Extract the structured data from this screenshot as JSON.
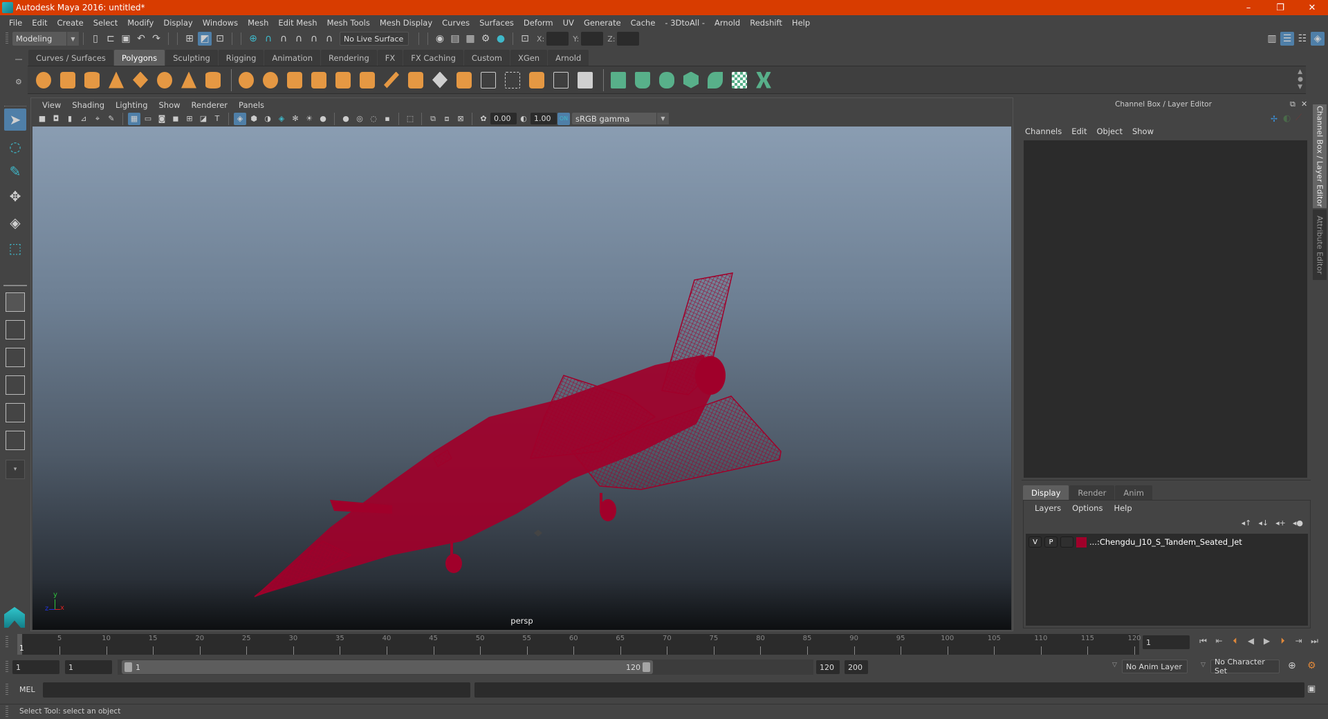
{
  "window": {
    "title": "Autodesk Maya 2016: untitled*",
    "controls": {
      "minimize": "–",
      "restore": "❐",
      "close": "✕"
    }
  },
  "menubar": [
    "File",
    "Edit",
    "Create",
    "Select",
    "Modify",
    "Display",
    "Windows",
    "Mesh",
    "Edit Mesh",
    "Mesh Tools",
    "Mesh Display",
    "Curves",
    "Surfaces",
    "Deform",
    "UV",
    "Generate",
    "Cache",
    "- 3DtoAll -",
    "Arnold",
    "Redshift",
    "Help"
  ],
  "statusline": {
    "menuset": "Modeling",
    "live_surface": "No Live Surface",
    "x_label": "X:",
    "y_label": "Y:",
    "z_label": "Z:",
    "x_value": "",
    "y_value": "",
    "z_value": ""
  },
  "shelf": {
    "tabs": [
      "Curves / Surfaces",
      "Polygons",
      "Sculpting",
      "Rigging",
      "Animation",
      "Rendering",
      "FX",
      "FX Caching",
      "Custom",
      "XGen",
      "Arnold"
    ],
    "active_tab": "Polygons",
    "icons": [
      "poly-sphere",
      "poly-cube",
      "poly-cylinder",
      "poly-cone",
      "poly-plane",
      "poly-torus",
      "poly-pyramid",
      "poly-pipe",
      "combine",
      "separate",
      "mirror",
      "smooth",
      "bevel",
      "bridge",
      "extrude",
      "multi-cut",
      "quad-draw",
      "target-weld",
      "connect",
      "edge-loop",
      "insert-edge-loop",
      "offset-edge-loop",
      "planar-mapping",
      "automatic-mapping",
      "cylindrical-mapping",
      "spherical-mapping",
      "uv-editor",
      "unfold",
      "layout-uvs",
      "transfer-attributes"
    ]
  },
  "viewport": {
    "menu": [
      "View",
      "Shading",
      "Lighting",
      "Show",
      "Renderer",
      "Panels"
    ],
    "exposure": "0.00",
    "gamma": "1.00",
    "color_space": "sRGB gamma",
    "camera_label": "persp",
    "axis_labels": {
      "x": "x",
      "y": "y",
      "z": "z"
    },
    "wireframe_color": "#a0002a"
  },
  "channel_box": {
    "title": "Channel Box / Layer Editor",
    "menu": [
      "Channels",
      "Edit",
      "Object",
      "Show"
    ]
  },
  "layer_editor": {
    "tabs": [
      "Display",
      "Render",
      "Anim"
    ],
    "active_tab": "Display",
    "menu": [
      "Layers",
      "Options",
      "Help"
    ],
    "layers": [
      {
        "visible": "V",
        "playback": "P",
        "color": "#a0002a",
        "name": "...:Chengdu_J10_S_Tandem_Seated_Jet"
      }
    ]
  },
  "side_tabs": [
    "Channel Box / Layer Editor",
    "Attribute Editor"
  ],
  "timeline": {
    "ticks": [
      5,
      10,
      15,
      20,
      25,
      30,
      35,
      40,
      45,
      50,
      55,
      60,
      65,
      70,
      75,
      80,
      85,
      90,
      95,
      100,
      105,
      110,
      115,
      120
    ],
    "current_frame": "1",
    "current_frame_field": "1",
    "playback_buttons": [
      "go-to-start",
      "step-back-key",
      "step-back-frame",
      "play-backwards",
      "play-forwards",
      "step-forward-frame",
      "step-forward-key",
      "go-to-end"
    ]
  },
  "range": {
    "start_time": "1",
    "playback_start": "1",
    "slider_start": "1",
    "slider_end": "120",
    "playback_end": "120",
    "end_time": "200",
    "anim_layer": "No Anim Layer",
    "character_set": "No Character Set"
  },
  "command_line": {
    "label": "MEL",
    "input": "",
    "output": ""
  },
  "help_line": "Select Tool: select an object"
}
